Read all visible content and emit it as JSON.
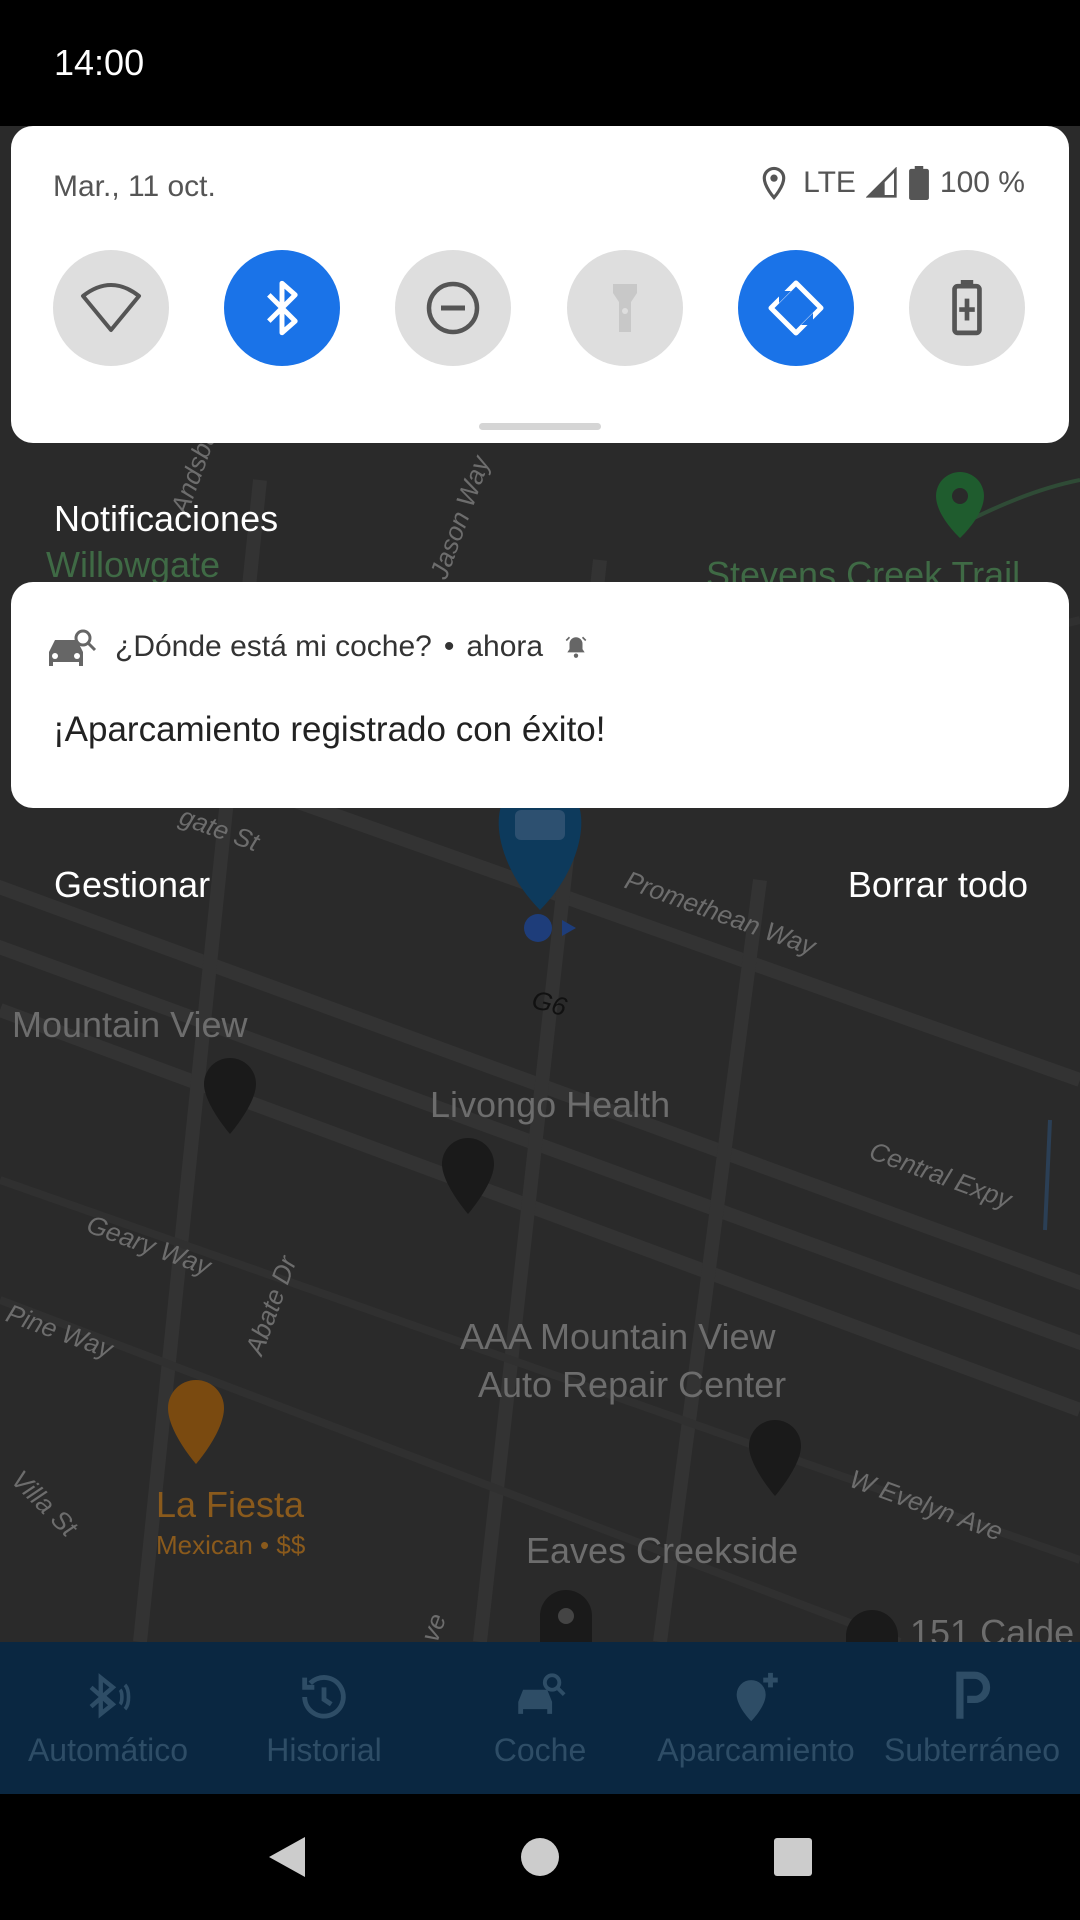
{
  "status_bar": {
    "time": "14:00"
  },
  "quick_settings": {
    "date": "Mar., 11 oct.",
    "network": "LTE",
    "battery": "100 %",
    "tiles": [
      {
        "icon": "wifi-icon",
        "active": false
      },
      {
        "icon": "bluetooth-icon",
        "active": true
      },
      {
        "icon": "do-not-disturb-icon",
        "active": false
      },
      {
        "icon": "flashlight-icon",
        "active": false
      },
      {
        "icon": "auto-rotate-icon",
        "active": true
      },
      {
        "icon": "battery-saver-icon",
        "active": false
      }
    ],
    "colors": {
      "active": "#1a73e8",
      "inactive": "#dedede"
    }
  },
  "notifications": {
    "header": "Notificaciones",
    "items": [
      {
        "app_name": "¿Dónde está mi coche?",
        "time": "ahora",
        "text": "¡Aparcamiento registrado con éxito!"
      }
    ],
    "manage_label": "Gestionar",
    "clear_all_label": "Borrar todo"
  },
  "map": {
    "labels": {
      "willowgate": "Willowgate",
      "stevens_creek": "Stevens Creek Trail",
      "mountain_view": "Mountain View",
      "livongo": "Livongo Health",
      "central_expy": "Central Expy",
      "geary_way": "Geary Way",
      "abate_dr": "Abate Dr",
      "pine_way": "Pine Way",
      "aaa_line1": "AAA Mountain View",
      "aaa_line2": "Auto Repair Center",
      "w_evelyn": "W Evelyn Ave",
      "la_fiesta": "La Fiesta",
      "la_fiesta_sub": "Mexican • $$",
      "villa_st": "Villa St",
      "eaves": "Eaves Creekside",
      "promethean": "Promethean Way",
      "g6": "G6",
      "jason_way": "Jason Way",
      "andsbu": "Andsbu",
      "gate_st": "gate St",
      "calde": "151 Calde",
      "ve": "ve"
    }
  },
  "app_nav": {
    "items": [
      {
        "label": "Automático",
        "icon": "bluetooth-auto-icon"
      },
      {
        "label": "Historial",
        "icon": "history-icon"
      },
      {
        "label": "Coche",
        "icon": "car-search-icon"
      },
      {
        "label": "Aparcamiento",
        "icon": "add-location-icon"
      },
      {
        "label": "Subterráneo",
        "icon": "parking-icon"
      }
    ]
  }
}
